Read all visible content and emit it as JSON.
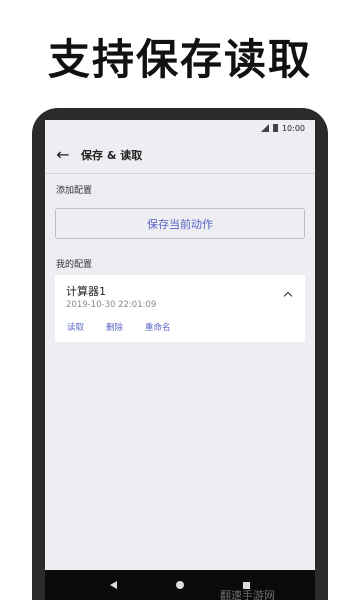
{
  "headline": "支持保存读取",
  "status_bar": {
    "time": "10:00",
    "icons": [
      "signal-icon",
      "battery-icon"
    ]
  },
  "app_bar": {
    "title": "保存 & 读取",
    "back_icon": "arrow-left-icon"
  },
  "add_section": {
    "label": "添加配置",
    "save_button": "保存当前动作"
  },
  "my_section": {
    "label": "我的配置",
    "configs": [
      {
        "name": "计算器1",
        "time": "2019-10-30 22:01:09",
        "actions": [
          "读取",
          "删除",
          "重命名"
        ]
      }
    ]
  },
  "nav_bar": {
    "buttons": [
      "back-icon",
      "home-icon",
      "recents-icon"
    ]
  },
  "watermark": "翻速手游网",
  "colors": {
    "accent": "#5a63c8",
    "screen_bg": "#eeedf2",
    "phone_frame": "#2b2b2b"
  }
}
